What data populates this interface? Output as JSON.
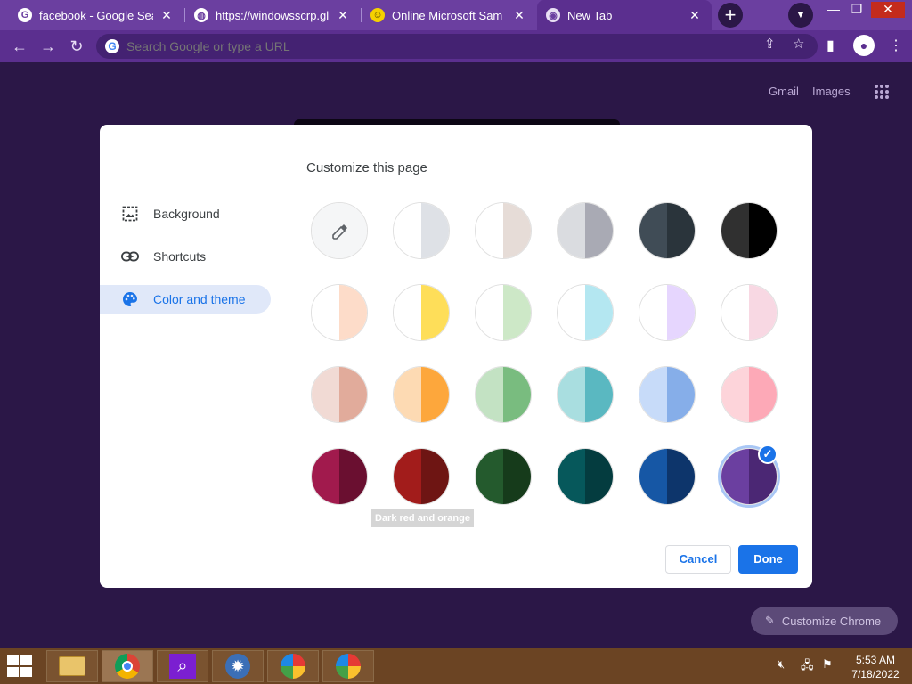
{
  "tabs": [
    {
      "title": "facebook - Google Search",
      "favicon": "google-icon"
    },
    {
      "title": "https://windowsscrp.glitch",
      "favicon": "globe-icon"
    },
    {
      "title": "Online Microsoft Sam TTS",
      "favicon": "smiley-icon"
    },
    {
      "title": "New Tab",
      "favicon": "chrome-icon"
    }
  ],
  "omnibox": {
    "placeholder": "Search Google or type a URL"
  },
  "ntp_links": {
    "gmail": "Gmail",
    "images": "Images"
  },
  "dialog": {
    "title": "Customize this page",
    "sidebar": [
      {
        "label": "Background"
      },
      {
        "label": "Shortcuts"
      },
      {
        "label": "Color and theme",
        "selected": true
      }
    ],
    "swatches": [
      {
        "left": "#f5f6f7",
        "right": "#f5f6f7",
        "name": "custom-color-picker"
      },
      {
        "left": "#ffffff",
        "right": "#dee1e6",
        "name": "default-light"
      },
      {
        "left": "#ffffff",
        "right": "#e6dcd7",
        "name": "warm-grey"
      },
      {
        "left": "#dadce0",
        "right": "#a9aab4",
        "name": "cool-grey"
      },
      {
        "left": "#404c56",
        "right": "#2a343b",
        "name": "dark-slate"
      },
      {
        "left": "#303030",
        "right": "#000000",
        "name": "black"
      },
      {
        "left": "#ffffff",
        "right": "#fddcc9",
        "name": "beige"
      },
      {
        "left": "#ffffff",
        "right": "#fede59",
        "name": "yellow"
      },
      {
        "left": "#ffffff",
        "right": "#cde8c7",
        "name": "green-light"
      },
      {
        "left": "#ffffff",
        "right": "#b4e7f1",
        "name": "light-teal"
      },
      {
        "left": "#ffffff",
        "right": "#e6d6fe",
        "name": "light-purple"
      },
      {
        "left": "#ffffff",
        "right": "#f8d8e3",
        "name": "pink"
      },
      {
        "left": "#f1dad4",
        "right": "#e1ab9b",
        "name": "beige-dark"
      },
      {
        "left": "#fddab3",
        "right": "#fda73c",
        "name": "orange"
      },
      {
        "left": "#c3e2c3",
        "right": "#79bc7f",
        "name": "light-green"
      },
      {
        "left": "#a9dee0",
        "right": "#5ab8c1",
        "name": "light-teal-2"
      },
      {
        "left": "#c7dbf9",
        "right": "#86aee9",
        "name": "light-blue"
      },
      {
        "left": "#fdd4da",
        "right": "#fda9b7",
        "name": "light-pink"
      },
      {
        "left": "#a11a4d",
        "right": "#6a0f30",
        "name": "dark-pink-red"
      },
      {
        "left": "#a21c1b",
        "right": "#6e1513",
        "name": "dark-red-orange"
      },
      {
        "left": "#245a2d",
        "right": "#163b1b",
        "name": "dark-green"
      },
      {
        "left": "#06585b",
        "right": "#043c3f",
        "name": "dark-teal"
      },
      {
        "left": "#1657a5",
        "right": "#0d356b",
        "name": "dark-blue"
      },
      {
        "left": "#6b3fa0",
        "right": "#4b2774",
        "name": "dark-purple",
        "selected": true
      }
    ],
    "tooltip": "Dark red and orange",
    "cancel_label": "Cancel",
    "done_label": "Done"
  },
  "customize_chrome_label": "Customize Chrome",
  "taskbar": {
    "time": "5:53 AM",
    "date": "7/18/2022"
  },
  "colors": {
    "accent": "#1a73e8",
    "theme_dark": "#2b1747",
    "theme_frame": "#6b3fa0"
  }
}
